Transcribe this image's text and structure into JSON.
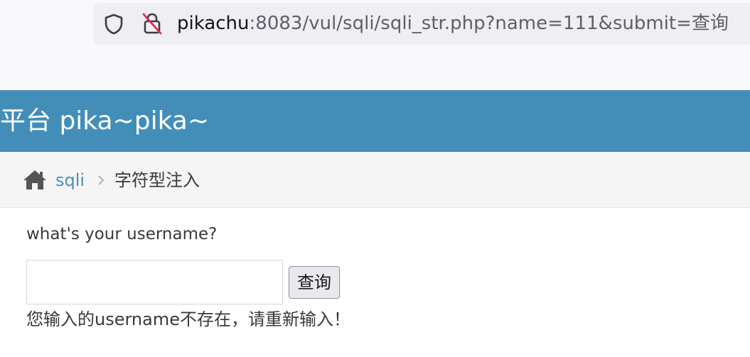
{
  "browser": {
    "url_host": "pikachu",
    "url_rest": ":8083/vul/sqli/sqli_str.php?name=111&submit=查询",
    "icons": [
      "shield-icon",
      "lock-slash-icon"
    ]
  },
  "header": {
    "title": "习平台 pika~pika~"
  },
  "breadcrumb": {
    "home_icon": "home-icon",
    "link": "sqli",
    "separator_icon": "chevron-right-icon",
    "current": "字符型注入"
  },
  "form": {
    "prompt": "what's your username?",
    "input_value": "",
    "submit_label": "查询"
  },
  "result": {
    "message": "您输入的username不存在，请重新输入！"
  },
  "colors": {
    "header_bg": "#438eb9",
    "link": "#4c8fbd",
    "text": "#393939"
  }
}
